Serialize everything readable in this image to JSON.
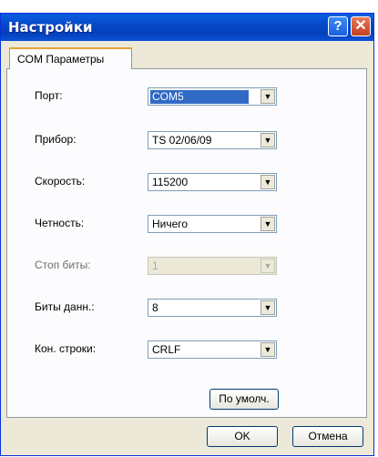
{
  "window": {
    "title": "Настройки",
    "help_icon": "question-mark-icon",
    "close_icon": "close-x-icon"
  },
  "tab": {
    "label": "COM Параметры"
  },
  "fields": [
    {
      "label": "Порт:",
      "value": "COM5",
      "selected": true,
      "enabled": true
    },
    {
      "label": "Прибор:",
      "value": "TS 02/06/09",
      "selected": false,
      "enabled": true
    },
    {
      "label": "Скорость:",
      "value": "115200",
      "selected": false,
      "enabled": true
    },
    {
      "label": "Четность:",
      "value": "Ничего",
      "selected": false,
      "enabled": true
    },
    {
      "label": "Стоп биты:",
      "value": "1",
      "selected": false,
      "enabled": false
    },
    {
      "label": "Биты данн.:",
      "value": "8",
      "selected": false,
      "enabled": true
    },
    {
      "label": "Кон. строки:",
      "value": "CRLF",
      "selected": false,
      "enabled": true
    }
  ],
  "buttons": {
    "defaults": "По умолч.",
    "ok": "OK",
    "cancel": "Отмена"
  },
  "colors": {
    "titlebar": "#0a5fe0",
    "selection": "#316ac5",
    "dialog_bg": "#ece9d8"
  }
}
